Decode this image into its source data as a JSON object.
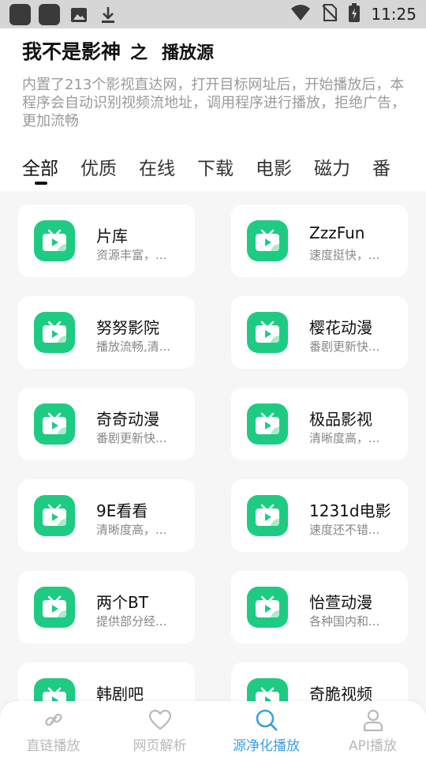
{
  "status_bar": {
    "time": "11:25",
    "left_icons": [
      "app-icon",
      "app-icon",
      "image-icon",
      "download-icon"
    ],
    "right_icons": [
      "wifi-icon",
      "no-sim-icon",
      "battery-charging-icon"
    ]
  },
  "header": {
    "title_main": "我不是影神",
    "title_joiner": "之",
    "title_sub": "播放源",
    "description": "内置了213个影视直达网，打开目标网址后，开始播放后，本程序会自动识别视频流地址，调用程序进行播放，拒绝广告，更加流畅"
  },
  "tabs": [
    {
      "label": "全部",
      "active": true
    },
    {
      "label": "优质",
      "active": false
    },
    {
      "label": "在线",
      "active": false
    },
    {
      "label": "下载",
      "active": false
    },
    {
      "label": "电影",
      "active": false
    },
    {
      "label": "磁力",
      "active": false
    },
    {
      "label": "番",
      "active": false
    }
  ],
  "sources": [
    {
      "name": "片库",
      "desc": "资源丰富，..."
    },
    {
      "name": "ZzzFun",
      "desc": "速度挺快，..."
    },
    {
      "name": "努努影院",
      "desc": "播放流畅,清..."
    },
    {
      "name": "樱花动漫",
      "desc": "番剧更新快..."
    },
    {
      "name": "奇奇动漫",
      "desc": "番剧更新快..."
    },
    {
      "name": "极品影视",
      "desc": "清晰度高，..."
    },
    {
      "name": "9E看看",
      "desc": "清晰度高，..."
    },
    {
      "name": "1231d电影",
      "desc": "速度还不错..."
    },
    {
      "name": "两个BT",
      "desc": "提供部分经..."
    },
    {
      "name": "怡萱动漫",
      "desc": "各种国内和..."
    },
    {
      "name": "韩剧吧",
      "desc": ""
    },
    {
      "name": "奇脆视频",
      "desc": ""
    }
  ],
  "bottom_nav": [
    {
      "label": "直链播放",
      "icon": "link-icon",
      "active": false
    },
    {
      "label": "网页解析",
      "icon": "heart-icon",
      "active": false
    },
    {
      "label": "源净化播放",
      "icon": "search-icon",
      "active": true
    },
    {
      "label": "API播放",
      "icon": "user-icon",
      "active": false
    }
  ],
  "colors": {
    "accent_green": "#1ecb82",
    "nav_active": "#3aa0e0",
    "nav_inactive": "#b9b9b9"
  }
}
